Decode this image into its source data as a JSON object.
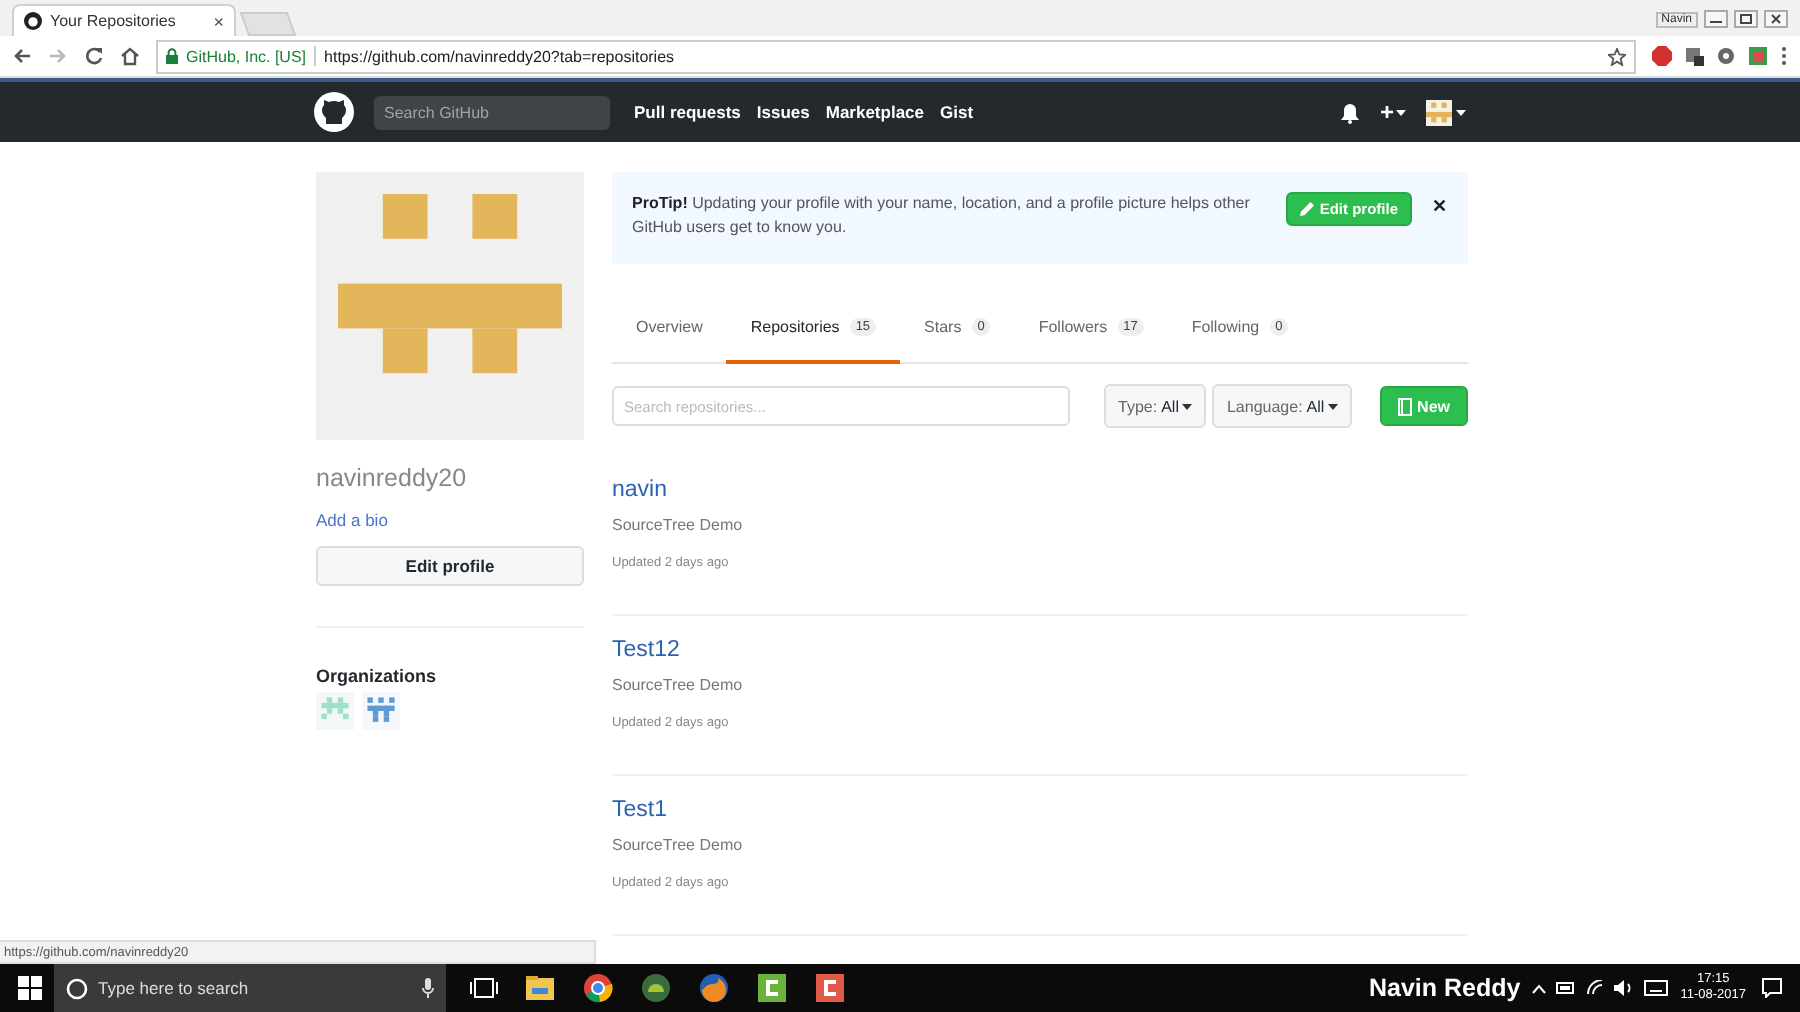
{
  "browser": {
    "tab_title": "Your Repositories",
    "tab_close": "×",
    "window_user": "Navin",
    "site_identity": "GitHub, Inc. [US]",
    "url": "https://github.com/navinreddy20?tab=repositories"
  },
  "header": {
    "search_placeholder": "Search GitHub",
    "nav": [
      "Pull requests",
      "Issues",
      "Marketplace",
      "Gist"
    ],
    "plus": "+"
  },
  "profile": {
    "username": "navinreddy20",
    "bio_link": "Add a bio",
    "edit_button": "Edit profile",
    "organizations_title": "Organizations"
  },
  "protip": {
    "text": "**ProTip!** Updating your profile with your name, location, and a profile picture helps other GitHub users get to know you.",
    "button": "Edit profile",
    "close": "✕"
  },
  "tabs": [
    {
      "label": "Overview",
      "selected": false
    },
    {
      "label": "Repositories",
      "count": "15",
      "selected": true
    },
    {
      "label": "Stars",
      "count": "0",
      "selected": false
    },
    {
      "label": "Followers",
      "count": "17",
      "selected": false
    },
    {
      "label": "Following",
      "count": "0",
      "selected": false
    }
  ],
  "filters": {
    "search_placeholder": "Search repositories...",
    "type_label": "Type:",
    "type_value": "All",
    "language_label": "Language:",
    "language_value": "All",
    "new_button": "New"
  },
  "repos": [
    {
      "name": "navin",
      "description": "SourceTree Demo",
      "updated": "Updated 2 days ago"
    },
    {
      "name": "Test12",
      "description": "SourceTree Demo",
      "updated": "Updated 2 days ago"
    },
    {
      "name": "Test1",
      "description": "SourceTree Demo",
      "updated": "Updated 2 days ago"
    }
  ],
  "status_bar": "https://github.com/navinreddy20",
  "taskbar": {
    "search_placeholder": "Type here to search",
    "user": "Navin Reddy",
    "time": "17:15",
    "date": "11-08-2017"
  }
}
